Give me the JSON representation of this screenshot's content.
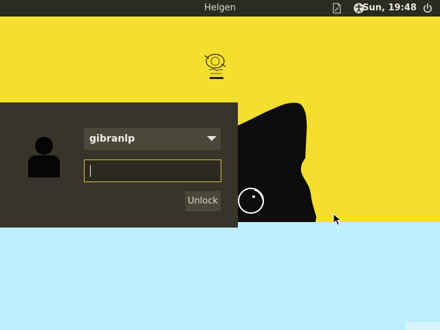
{
  "topbar": {
    "hostname": "Helgen",
    "clock": "Sun, 19:48",
    "indicators": [
      "document-icon",
      "accessibility-icon",
      "power-icon"
    ]
  },
  "wallpaper": {
    "colors": {
      "yellow": "#f4de2e",
      "blue": "#bdeffc"
    }
  },
  "login": {
    "username": "gibranlp",
    "password_value": "",
    "unlock_label": "Unlock"
  },
  "colors": {
    "panel": "#38342a",
    "accent": "#d6c545",
    "topbar": "#2c2b22"
  }
}
